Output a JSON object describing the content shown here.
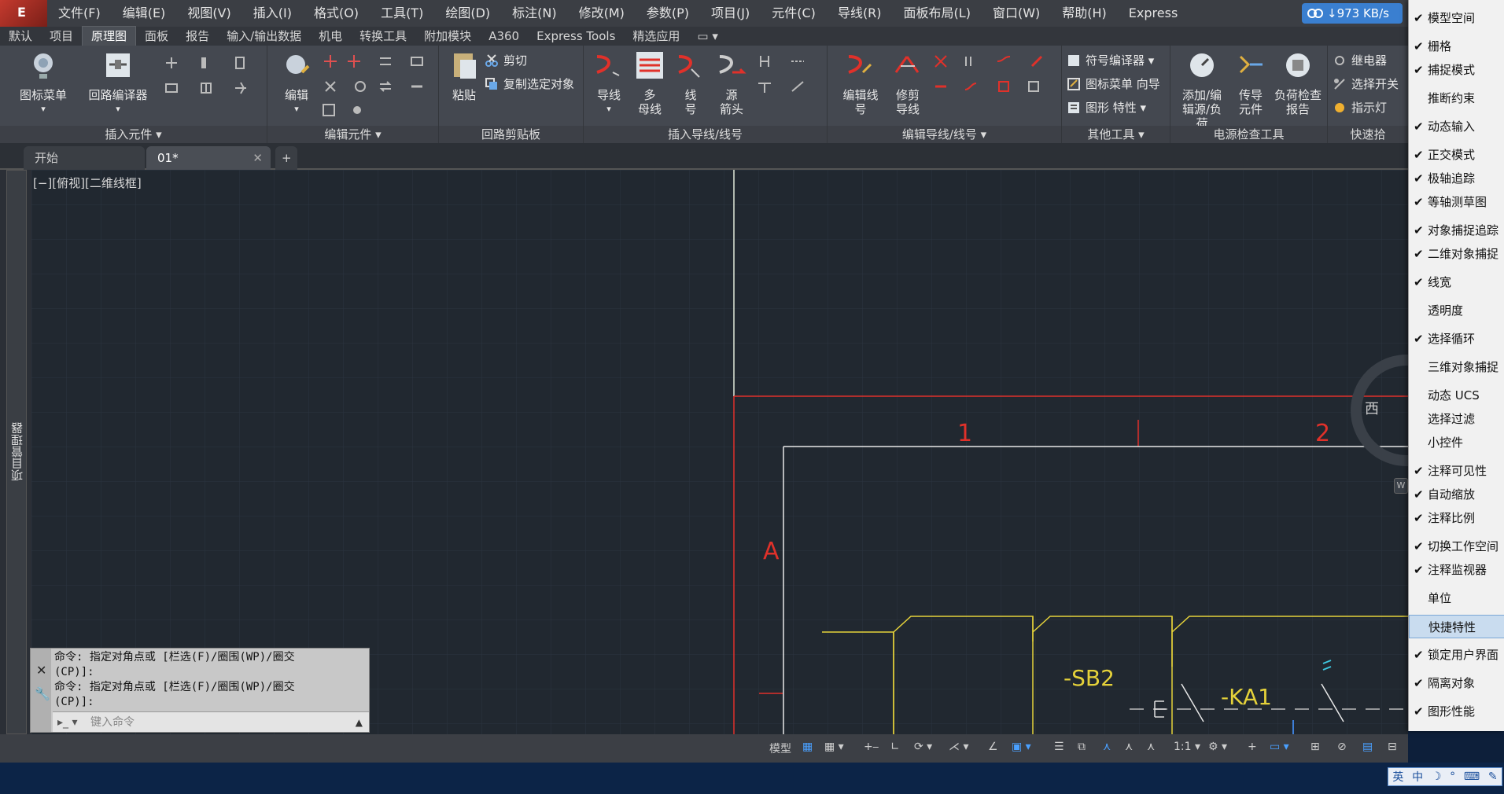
{
  "menubar": {
    "logo": "E",
    "items": [
      "文件(F)",
      "编辑(E)",
      "视图(V)",
      "插入(I)",
      "格式(O)",
      "工具(T)",
      "绘图(D)",
      "标注(N)",
      "修改(M)",
      "参数(P)",
      "项目(J)",
      "元件(C)",
      "导线(R)",
      "面板布局(L)",
      "窗口(W)",
      "帮助(H)",
      "Express"
    ],
    "net_speed": "↓973 KB/s"
  },
  "ribbon_tabs": [
    "默认",
    "项目",
    "原理图",
    "面板",
    "报告",
    "输入/输出数据",
    "机电",
    "转换工具",
    "附加模块",
    "A360",
    "Express Tools",
    "精选应用"
  ],
  "ribbon_active": "原理图",
  "ribbon": {
    "panel_insert": {
      "title": "插入元件 ▾",
      "btn1": "图标菜单",
      "btn2": "回路编译器"
    },
    "panel_edit": {
      "title": "编辑元件 ▾",
      "btn1": "编辑"
    },
    "panel_clip": {
      "title": "回路剪贴板",
      "paste": "粘贴",
      "cut": "剪切",
      "copy": "复制选定对象"
    },
    "panel_wire": {
      "title": "插入导线/线号",
      "wire": "导线",
      "multi1": "多",
      "multi2": "母线",
      "wnum1": "线",
      "wnum2": "号",
      "src1": "源",
      "src2": "箭头"
    },
    "panel_editwire": {
      "title": "编辑导线/线号 ▾",
      "ew1": "编辑线",
      "ew2": "号",
      "trim1": "修剪",
      "trim2": "导线"
    },
    "panel_other": {
      "title": "其他工具 ▾",
      "sym": "符号编译器",
      "menuwiz": "图标菜单 向导",
      "props": "图形 特性"
    },
    "panel_power": {
      "title": "电源检查工具",
      "add1": "添加/编",
      "add2": "辑源/负荷",
      "trans1": "传导",
      "trans2": "元件",
      "load1": "负荷检查",
      "load2": "报告"
    },
    "panel_quick": {
      "title": "快速拾",
      "relay": "继电器",
      "switch": "选择开关",
      "lamp": "指示灯"
    }
  },
  "doc_tabs": {
    "start": "开始",
    "active": "01*",
    "plus": "+"
  },
  "left_strip": "项目管理器",
  "canvas": {
    "view_label": "[−][俯视][二维线框]",
    "col1": "1",
    "col2": "2",
    "rowA": "A",
    "sb2": "-SB2",
    "ka1": "-KA1",
    "viewcube_west": "西"
  },
  "cmd": {
    "line1": "命令: 指定对角点或 [栏选(F)/圈围(WP)/圈交",
    "line2": "(CP)]:",
    "line3": "命令: 指定对角点或 [栏选(F)/圈围(WP)/圈交",
    "line4": "(CP)]:",
    "placeholder": "键入命令"
  },
  "statusbar": {
    "model": "模型",
    "scale": "1:1"
  },
  "popup": [
    {
      "label": "模型空间",
      "checked": true
    },
    {
      "label": "栅格",
      "checked": true
    },
    {
      "label": "捕捉模式",
      "checked": true
    },
    {
      "label": "推断约束",
      "checked": false
    },
    {
      "label": "动态输入",
      "checked": true
    },
    {
      "label": "正交模式",
      "checked": true
    },
    {
      "label": "极轴追踪",
      "checked": true
    },
    {
      "label": "等轴测草图",
      "checked": true
    },
    {
      "label": "对象捕捉追踪",
      "checked": true
    },
    {
      "label": "二维对象捕捉",
      "checked": true
    },
    {
      "label": "线宽",
      "checked": true
    },
    {
      "label": "透明度",
      "checked": false
    },
    {
      "label": "选择循环",
      "checked": true
    },
    {
      "label": "三维对象捕捉",
      "checked": false
    },
    {
      "label": "动态 UCS",
      "checked": false
    },
    {
      "label": "选择过滤",
      "checked": false
    },
    {
      "label": "小控件",
      "checked": false
    },
    {
      "label": "注释可见性",
      "checked": true
    },
    {
      "label": "自动缩放",
      "checked": true
    },
    {
      "label": "注释比例",
      "checked": true
    },
    {
      "label": "切换工作空间",
      "checked": true
    },
    {
      "label": "注释监视器",
      "checked": true
    },
    {
      "label": "单位",
      "checked": false
    },
    {
      "label": "快捷特性",
      "checked": false,
      "highlighted": true
    },
    {
      "label": "锁定用户界面",
      "checked": true
    },
    {
      "label": "隔离对象",
      "checked": true
    },
    {
      "label": "图形性能",
      "checked": true
    }
  ],
  "ime": [
    "英",
    "中",
    "☽",
    "°",
    "⌨",
    "✎"
  ],
  "colors": {
    "red": "#e0312a",
    "yellow": "#e5d23a",
    "white": "#e8e8e8",
    "cyan": "#3ec7e0"
  }
}
